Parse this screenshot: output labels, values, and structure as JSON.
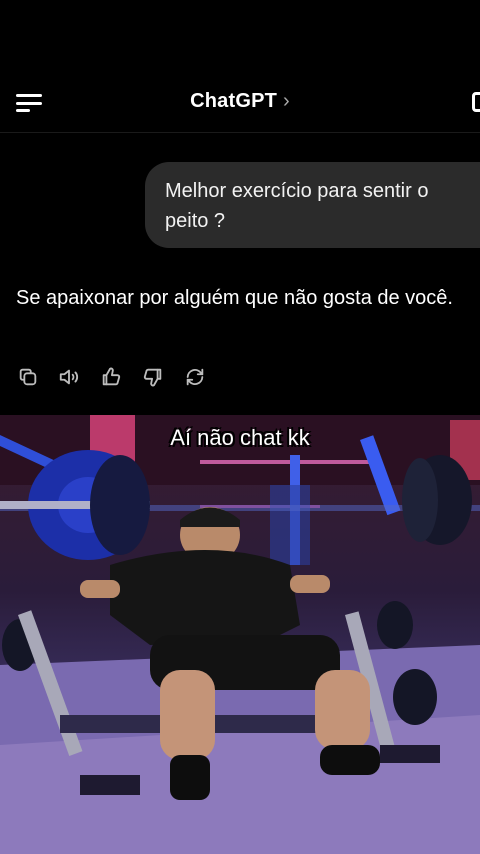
{
  "header": {
    "title": "ChatGPT",
    "chevron": "›",
    "menu_icon": "menu-icon",
    "edit_icon": "new-chat-icon"
  },
  "messages": {
    "user": "Melhor exercício para sentir o peito ?",
    "assistant": "Se apaixonar por alguém que não gosta de você."
  },
  "actions": [
    "copy-icon",
    "speaker-icon",
    "thumbs-up-icon",
    "thumbs-down-icon",
    "regenerate-icon"
  ],
  "video": {
    "caption": "Aí não chat kk"
  },
  "colors": {
    "background": "#000000",
    "bubble": "#2b2b2b",
    "icon": "#bdbdbd"
  }
}
